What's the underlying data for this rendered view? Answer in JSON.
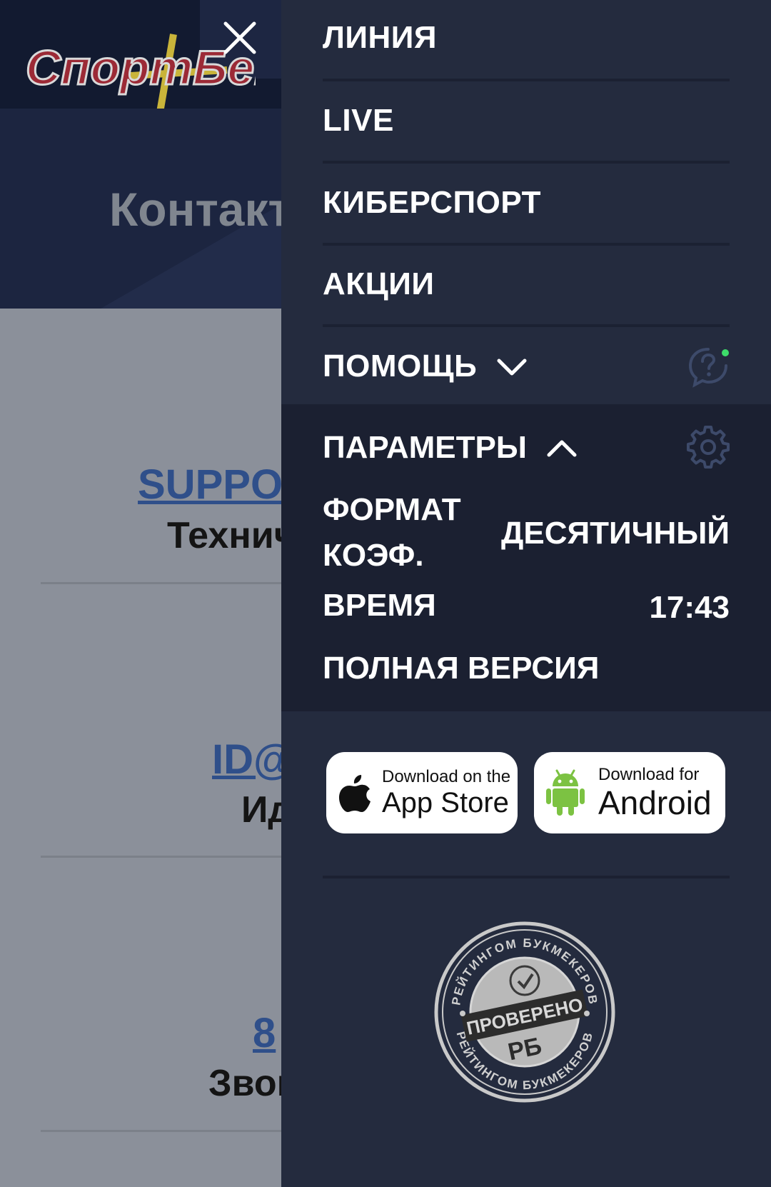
{
  "background": {
    "logo_text": "СпортБет",
    "title": "Контакт",
    "contacts": [
      {
        "link": "SUPPO",
        "label": "Технич"
      },
      {
        "link": "ID@",
        "label": "Ид"
      },
      {
        "link": "8",
        "label": "Звон"
      }
    ]
  },
  "drawer": {
    "menu": [
      {
        "label": "ЛИНИЯ"
      },
      {
        "label": "LIVE"
      },
      {
        "label": "КИБЕРСПОРТ"
      },
      {
        "label": "АКЦИИ"
      },
      {
        "label": "ПОМОЩЬ"
      }
    ],
    "params": {
      "title": "ПАРАМЕТРЫ",
      "odds_format_label_line1": "ФОРМАТ",
      "odds_format_label_line2": "КОЭФ.",
      "odds_format_value": "ДЕСЯТИЧНЫЙ",
      "time_label": "ВРЕМЯ",
      "time_value": "17:43",
      "full_version": "ПОЛНАЯ ВЕРСИЯ"
    },
    "app_store": {
      "small": "Download on the",
      "big": "App Store"
    },
    "android": {
      "small": "Download for",
      "big": "Android"
    },
    "seal": {
      "top_text": "РЕЙТИНГОМ БУКМЕКЕРОВ",
      "center_text": "ПРОВЕРЕНО",
      "badge": "РБ",
      "bottom_text": "РЕЙТИНГОМ БУКМЕКЕРОВ"
    }
  },
  "colors": {
    "drawer_bg": "#242b3e",
    "params_bg": "#1b2031",
    "online_dot": "#3ddc6a",
    "android_green": "#7cc242"
  }
}
